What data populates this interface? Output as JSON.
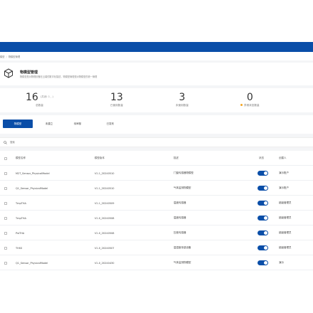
{
  "breadcrumb": {
    "items": [
      "模型",
      "物模型管理"
    ]
  },
  "header": {
    "title": "物模型管理",
    "description": "物模型是对物理设备在云端的数字化描述，物模型管理是对物模型的统一管理"
  },
  "stats": [
    {
      "value": "16",
      "sub": "(共闭: 1 , )",
      "caption": "总数量"
    },
    {
      "value": "13",
      "sub": "",
      "caption": "已使用数量"
    },
    {
      "value": "3",
      "sub": "",
      "caption": "未使用数量"
    },
    {
      "value": "0",
      "sub": "",
      "caption": "异常状态数量",
      "dot": true
    }
  ],
  "tabs": [
    {
      "label": "物模型",
      "active": true
    },
    {
      "label": "未建立",
      "active": false
    },
    {
      "label": "待审核",
      "active": false
    },
    {
      "label": "已发布",
      "active": false
    }
  ],
  "search": {
    "placeholder": "搜索"
  },
  "table": {
    "columns": [
      "模型名称",
      "模型版本",
      "描述",
      "状态",
      "创建人"
    ],
    "rows": [
      {
        "name": "M2T_Sensor_PhysicalModel",
        "version": "V1.1_20240510",
        "desc": "门窗传感器物模型",
        "status": true,
        "creator": "演示账户"
      },
      {
        "name": "Q1_Sensor_PhysicalModel",
        "version": "V1.1_20240510",
        "desc": "气体监测物模型",
        "status": true,
        "creator": "演示账户"
      },
      {
        "name": "TmpTHA",
        "version": "V1.1_20240509",
        "desc": "温度传感器",
        "status": true,
        "creator": "超级管理员"
      },
      {
        "name": "TmpTHA",
        "version": "V1.0_20240508",
        "desc": "温度传感器",
        "status": true,
        "creator": "超级管理员"
      },
      {
        "name": "PwTHA",
        "version": "V1.0_20240508",
        "desc": "压差传感器",
        "status": true,
        "creator": "超级管理员"
      },
      {
        "name": "THSS",
        "version": "V1.0_20240507",
        "desc": "温湿度传感设备",
        "status": true,
        "creator": "超级管理员"
      },
      {
        "name": "Q1_Sensor_PhysicalModel",
        "version": "V1.0_20240430",
        "desc": "气体监测物模型",
        "status": true,
        "creator": "演示"
      }
    ]
  },
  "colors": {
    "primary": "#0a4ea8",
    "warning": "#f5a623"
  }
}
